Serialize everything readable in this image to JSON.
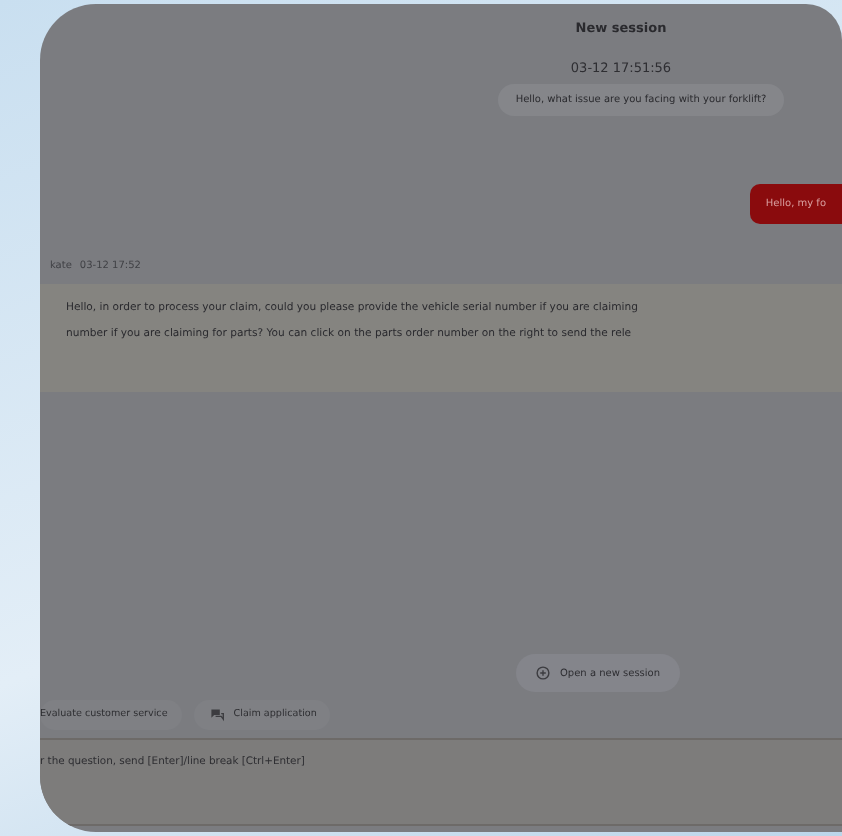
{
  "header": {
    "title": "New session",
    "time": "03-12 17:51:56"
  },
  "messages": [
    {
      "kind": "bot",
      "text": "Hello, what issue are you facing with your forklift?"
    },
    {
      "kind": "user",
      "text": "Hello, my fo"
    },
    {
      "kind": "agent",
      "sender": "kate",
      "time": "03-12 17:52",
      "lines": [
        "Hello, in order to process your claim, could you please provide the vehicle serial number if you are claiming",
        "number if you are claiming for parts? You can click on the parts order number on the right to send the rele"
      ]
    }
  ],
  "new_session_button": "Open a new session",
  "quick_actions": [
    "Evaluate customer service",
    "Claim application"
  ],
  "input": {
    "placeholder": "r the question, send [Enter]/line break [Ctrl+Enter]"
  }
}
